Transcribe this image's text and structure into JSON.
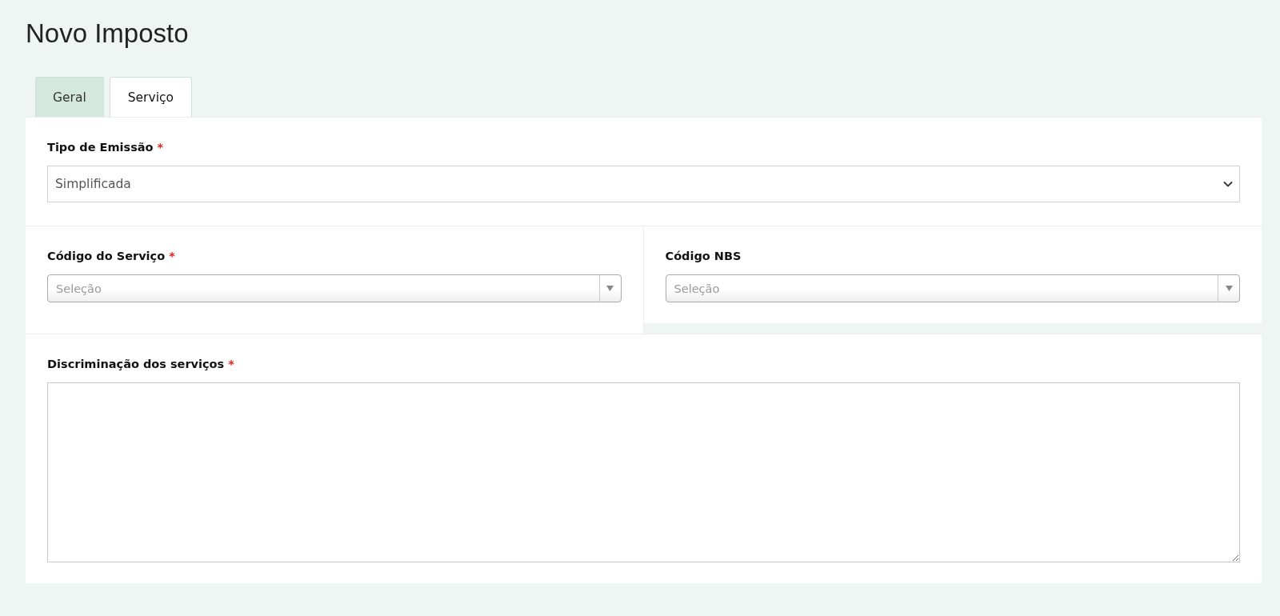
{
  "page_title": "Novo Imposto",
  "tabs": [
    {
      "label": "Geral",
      "selected": false
    },
    {
      "label": "Serviço",
      "selected": true
    }
  ],
  "rows": [
    [
      {
        "kind": "select",
        "label": "Tipo de Emissão",
        "required_mark": "*",
        "value": "Simplificada"
      }
    ],
    [
      {
        "kind": "combo",
        "label": "Código do Serviço",
        "required_mark": "*",
        "placeholder": "Seleção"
      },
      {
        "kind": "combo",
        "label": "Código NBS",
        "placeholder": "Seleção"
      }
    ],
    [
      {
        "kind": "textarea",
        "label": "Discriminação dos serviços",
        "required_mark": "*"
      }
    ]
  ]
}
